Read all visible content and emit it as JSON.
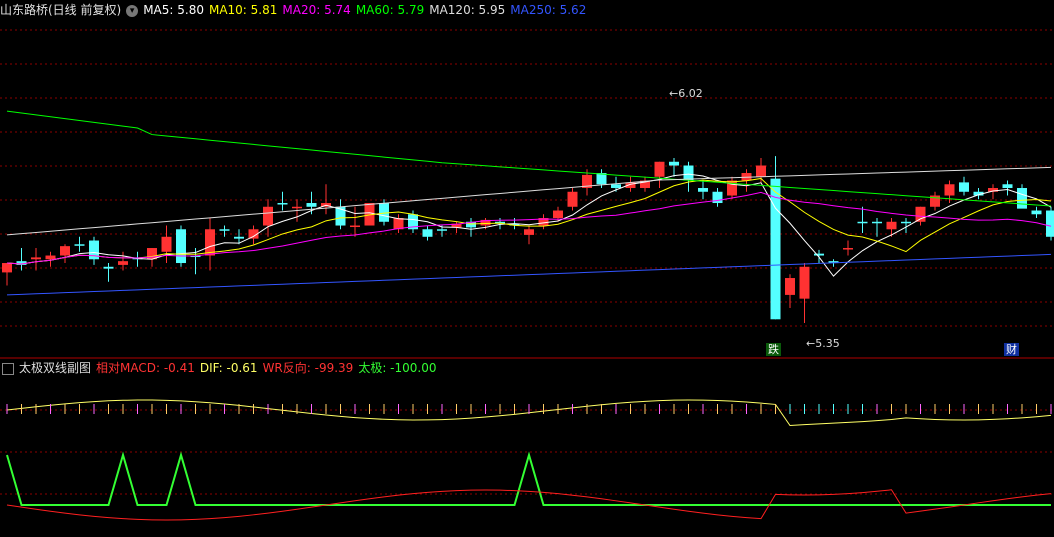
{
  "header": {
    "stock": "山东路桥(日线 前复权)",
    "ma": [
      {
        "label": "MA5: 5.80",
        "color": "#ffffff"
      },
      {
        "label": "MA10: 5.81",
        "color": "#ffff00"
      },
      {
        "label": "MA20: 5.74",
        "color": "#ff00ff"
      },
      {
        "label": "MA60: 5.79",
        "color": "#00ff00"
      },
      {
        "label": "MA120: 5.95",
        "color": "#dddddd"
      },
      {
        "label": "MA250: 5.62",
        "color": "#3355ff"
      }
    ]
  },
  "indicator": {
    "name": "太极双线副图",
    "values": [
      {
        "label": "相对MACD: -0.41",
        "color": "#ff3333"
      },
      {
        "label": "DIF: -0.61",
        "color": "#ffff66"
      },
      {
        "label": "WR反向: -99.39",
        "color": "#ff3333"
      },
      {
        "label": "太极: -100.00",
        "color": "#33ff33"
      }
    ]
  },
  "annotations": {
    "high_label": "6.02",
    "low_label": "5.35",
    "fall_marker": "跌",
    "finance_marker": "财"
  },
  "colors": {
    "up": "#ff3232",
    "down": "#54ffff",
    "grid": "#8b0000",
    "ma5": "#ffffff",
    "ma10": "#ffff00",
    "ma20": "#ff00ff",
    "ma60": "#00ff00",
    "ma120": "#dddddd",
    "ma250": "#3355ff",
    "taiji": "#33ff33",
    "wr": "#ff2020",
    "dif": "#ffff66"
  },
  "chart_data": {
    "type": "candlestick",
    "price_range": [
      5.2,
      6.4
    ],
    "candles": [
      {
        "o": 5.47,
        "h": 5.52,
        "l": 5.4,
        "c": 5.52,
        "dir": "up"
      },
      {
        "o": 5.53,
        "h": 5.6,
        "l": 5.48,
        "c": 5.51,
        "dir": "down"
      },
      {
        "o": 5.54,
        "h": 5.6,
        "l": 5.48,
        "c": 5.55,
        "dir": "up"
      },
      {
        "o": 5.54,
        "h": 5.58,
        "l": 5.5,
        "c": 5.56,
        "dir": "up"
      },
      {
        "o": 5.56,
        "h": 5.62,
        "l": 5.52,
        "c": 5.61,
        "dir": "up"
      },
      {
        "o": 5.62,
        "h": 5.66,
        "l": 5.58,
        "c": 5.62,
        "dir": "down"
      },
      {
        "o": 5.64,
        "h": 5.66,
        "l": 5.51,
        "c": 5.54,
        "dir": "down"
      },
      {
        "o": 5.5,
        "h": 5.52,
        "l": 5.42,
        "c": 5.49,
        "dir": "down"
      },
      {
        "o": 5.51,
        "h": 5.58,
        "l": 5.48,
        "c": 5.53,
        "dir": "up"
      },
      {
        "o": 5.55,
        "h": 5.58,
        "l": 5.5,
        "c": 5.54,
        "dir": "down"
      },
      {
        "o": 5.54,
        "h": 5.6,
        "l": 5.5,
        "c": 5.6,
        "dir": "up"
      },
      {
        "o": 5.58,
        "h": 5.72,
        "l": 5.52,
        "c": 5.66,
        "dir": "up"
      },
      {
        "o": 5.7,
        "h": 5.72,
        "l": 5.5,
        "c": 5.52,
        "dir": "down"
      },
      {
        "o": 5.56,
        "h": 5.6,
        "l": 5.46,
        "c": 5.56,
        "dir": "down"
      },
      {
        "o": 5.56,
        "h": 5.76,
        "l": 5.48,
        "c": 5.7,
        "dir": "up"
      },
      {
        "o": 5.7,
        "h": 5.72,
        "l": 5.66,
        "c": 5.7,
        "dir": "down"
      },
      {
        "o": 5.66,
        "h": 5.7,
        "l": 5.62,
        "c": 5.65,
        "dir": "down"
      },
      {
        "o": 5.65,
        "h": 5.72,
        "l": 5.62,
        "c": 5.7,
        "dir": "up"
      },
      {
        "o": 5.72,
        "h": 5.86,
        "l": 5.66,
        "c": 5.82,
        "dir": "up"
      },
      {
        "o": 5.84,
        "h": 5.9,
        "l": 5.8,
        "c": 5.84,
        "dir": "down"
      },
      {
        "o": 5.82,
        "h": 5.86,
        "l": 5.74,
        "c": 5.82,
        "dir": "up"
      },
      {
        "o": 5.84,
        "h": 5.9,
        "l": 5.78,
        "c": 5.82,
        "dir": "down"
      },
      {
        "o": 5.82,
        "h": 5.94,
        "l": 5.78,
        "c": 5.84,
        "dir": "up"
      },
      {
        "o": 5.82,
        "h": 5.86,
        "l": 5.7,
        "c": 5.72,
        "dir": "down"
      },
      {
        "o": 5.72,
        "h": 5.82,
        "l": 5.66,
        "c": 5.72,
        "dir": "up"
      },
      {
        "o": 5.72,
        "h": 5.82,
        "l": 5.72,
        "c": 5.84,
        "dir": "up"
      },
      {
        "o": 5.84,
        "h": 5.86,
        "l": 5.72,
        "c": 5.74,
        "dir": "down"
      },
      {
        "o": 5.7,
        "h": 5.78,
        "l": 5.68,
        "c": 5.76,
        "dir": "up"
      },
      {
        "o": 5.78,
        "h": 5.8,
        "l": 5.68,
        "c": 5.7,
        "dir": "down"
      },
      {
        "o": 5.7,
        "h": 5.72,
        "l": 5.64,
        "c": 5.66,
        "dir": "down"
      },
      {
        "o": 5.7,
        "h": 5.72,
        "l": 5.66,
        "c": 5.7,
        "dir": "down"
      },
      {
        "o": 5.71,
        "h": 5.74,
        "l": 5.68,
        "c": 5.73,
        "dir": "up"
      },
      {
        "o": 5.74,
        "h": 5.76,
        "l": 5.66,
        "c": 5.71,
        "dir": "down"
      },
      {
        "o": 5.72,
        "h": 5.76,
        "l": 5.7,
        "c": 5.75,
        "dir": "up"
      },
      {
        "o": 5.73,
        "h": 5.76,
        "l": 5.7,
        "c": 5.74,
        "dir": "down"
      },
      {
        "o": 5.73,
        "h": 5.76,
        "l": 5.7,
        "c": 5.72,
        "dir": "down"
      },
      {
        "o": 5.67,
        "h": 5.72,
        "l": 5.62,
        "c": 5.7,
        "dir": "up"
      },
      {
        "o": 5.72,
        "h": 5.78,
        "l": 5.7,
        "c": 5.76,
        "dir": "up"
      },
      {
        "o": 5.76,
        "h": 5.82,
        "l": 5.74,
        "c": 5.8,
        "dir": "up"
      },
      {
        "o": 5.82,
        "h": 5.92,
        "l": 5.8,
        "c": 5.9,
        "dir": "up"
      },
      {
        "o": 5.92,
        "h": 6.02,
        "l": 5.88,
        "c": 5.99,
        "dir": "up"
      },
      {
        "o": 6.0,
        "h": 6.02,
        "l": 5.92,
        "c": 5.94,
        "dir": "down"
      },
      {
        "o": 5.94,
        "h": 5.98,
        "l": 5.9,
        "c": 5.92,
        "dir": "down"
      },
      {
        "o": 5.92,
        "h": 5.98,
        "l": 5.9,
        "c": 5.95,
        "dir": "up"
      },
      {
        "o": 5.92,
        "h": 5.98,
        "l": 5.9,
        "c": 5.96,
        "dir": "up"
      },
      {
        "o": 5.98,
        "h": 6.06,
        "l": 5.92,
        "c": 6.06,
        "dir": "up"
      },
      {
        "o": 6.06,
        "h": 6.08,
        "l": 5.98,
        "c": 6.04,
        "dir": "down"
      },
      {
        "o": 6.04,
        "h": 6.06,
        "l": 5.9,
        "c": 5.96,
        "dir": "down"
      },
      {
        "o": 5.92,
        "h": 5.96,
        "l": 5.86,
        "c": 5.9,
        "dir": "down"
      },
      {
        "o": 5.9,
        "h": 5.92,
        "l": 5.82,
        "c": 5.84,
        "dir": "down"
      },
      {
        "o": 5.88,
        "h": 5.98,
        "l": 5.86,
        "c": 5.96,
        "dir": "up"
      },
      {
        "o": 5.96,
        "h": 6.02,
        "l": 5.9,
        "c": 6.0,
        "dir": "up"
      },
      {
        "o": 5.98,
        "h": 6.08,
        "l": 5.95,
        "c": 6.04,
        "dir": "up"
      },
      {
        "o": 5.97,
        "h": 6.09,
        "l": 5.22,
        "c": 5.22,
        "dir": "down"
      },
      {
        "o": 5.35,
        "h": 5.46,
        "l": 5.28,
        "c": 5.44,
        "dir": "up"
      },
      {
        "o": 5.33,
        "h": 5.52,
        "l": 5.2,
        "c": 5.5,
        "dir": "up"
      },
      {
        "o": 5.57,
        "h": 5.59,
        "l": 5.52,
        "c": 5.56,
        "dir": "down"
      },
      {
        "o": 5.52,
        "h": 5.54,
        "l": 5.5,
        "c": 5.53,
        "dir": "down"
      },
      {
        "o": 5.6,
        "h": 5.64,
        "l": 5.56,
        "c": 5.6,
        "dir": "up"
      },
      {
        "o": 5.74,
        "h": 5.82,
        "l": 5.68,
        "c": 5.74,
        "dir": "down"
      },
      {
        "o": 5.74,
        "h": 5.76,
        "l": 5.66,
        "c": 5.74,
        "dir": "down"
      },
      {
        "o": 5.7,
        "h": 5.76,
        "l": 5.66,
        "c": 5.74,
        "dir": "up"
      },
      {
        "o": 5.74,
        "h": 5.76,
        "l": 5.68,
        "c": 5.74,
        "dir": "down"
      },
      {
        "o": 5.74,
        "h": 5.82,
        "l": 5.72,
        "c": 5.82,
        "dir": "up"
      },
      {
        "o": 5.82,
        "h": 5.9,
        "l": 5.8,
        "c": 5.88,
        "dir": "up"
      },
      {
        "o": 5.88,
        "h": 5.96,
        "l": 5.84,
        "c": 5.94,
        "dir": "up"
      },
      {
        "o": 5.95,
        "h": 5.98,
        "l": 5.88,
        "c": 5.9,
        "dir": "down"
      },
      {
        "o": 5.9,
        "h": 5.92,
        "l": 5.86,
        "c": 5.88,
        "dir": "down"
      },
      {
        "o": 5.9,
        "h": 5.94,
        "l": 5.86,
        "c": 5.92,
        "dir": "up"
      },
      {
        "o": 5.94,
        "h": 5.96,
        "l": 5.88,
        "c": 5.92,
        "dir": "down"
      },
      {
        "o": 5.92,
        "h": 5.94,
        "l": 5.84,
        "c": 5.81,
        "dir": "down"
      },
      {
        "o": 5.8,
        "h": 5.82,
        "l": 5.76,
        "c": 5.78,
        "dir": "down"
      },
      {
        "o": 5.8,
        "h": 5.82,
        "l": 5.64,
        "c": 5.66,
        "dir": "down"
      }
    ]
  }
}
